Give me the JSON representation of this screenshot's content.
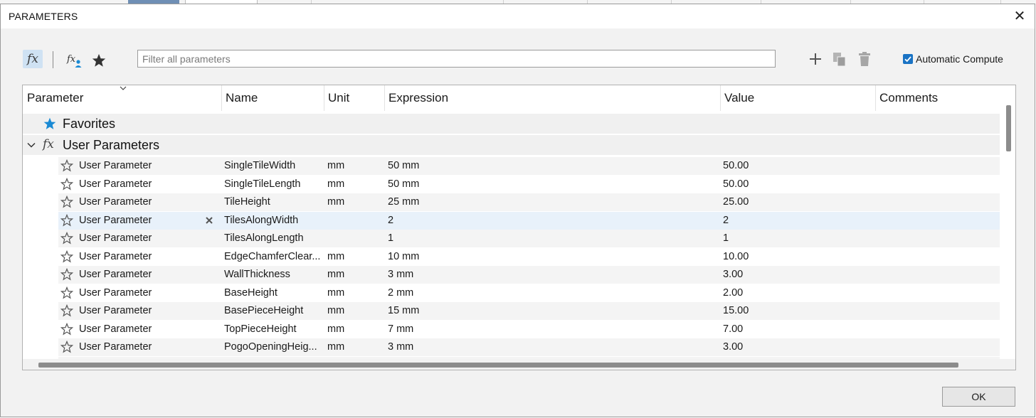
{
  "dialog": {
    "title": "PARAMETERS"
  },
  "toolbar": {
    "filter_placeholder": "Filter all parameters",
    "auto_compute_label": "Automatic Compute",
    "auto_compute_checked": true
  },
  "table": {
    "columns": [
      "Parameter",
      "Name",
      "Unit",
      "Expression",
      "Value",
      "Comments"
    ],
    "groups": {
      "favorites": "Favorites",
      "user": "User Parameters"
    },
    "rows": [
      {
        "param": "User Parameter",
        "name": "SingleTileWidth",
        "unit": "mm",
        "expr": "50 mm",
        "value": "50.00",
        "comment": ""
      },
      {
        "param": "User Parameter",
        "name": "SingleTileLength",
        "unit": "mm",
        "expr": "50 mm",
        "value": "50.00",
        "comment": ""
      },
      {
        "param": "User Parameter",
        "name": "TileHeight",
        "unit": "mm",
        "expr": "25 mm",
        "value": "25.00",
        "comment": ""
      },
      {
        "param": "User Parameter",
        "name": "TilesAlongWidth",
        "unit": "",
        "expr": "2",
        "value": "2",
        "comment": ""
      },
      {
        "param": "User Parameter",
        "name": "TilesAlongLength",
        "unit": "",
        "expr": "1",
        "value": "1",
        "comment": ""
      },
      {
        "param": "User Parameter",
        "name": "EdgeChamferClear...",
        "unit": "mm",
        "expr": "10 mm",
        "value": "10.00",
        "comment": ""
      },
      {
        "param": "User Parameter",
        "name": "WallThickness",
        "unit": "mm",
        "expr": "3 mm",
        "value": "3.00",
        "comment": ""
      },
      {
        "param": "User Parameter",
        "name": "BaseHeight",
        "unit": "mm",
        "expr": "2 mm",
        "value": "2.00",
        "comment": ""
      },
      {
        "param": "User Parameter",
        "name": "BasePieceHeight",
        "unit": "mm",
        "expr": "15 mm",
        "value": "15.00",
        "comment": ""
      },
      {
        "param": "User Parameter",
        "name": "TopPieceHeight",
        "unit": "mm",
        "expr": "7 mm",
        "value": "7.00",
        "comment": ""
      },
      {
        "param": "User Parameter",
        "name": "PogoOpeningHeig...",
        "unit": "mm",
        "expr": "3 mm",
        "value": "3.00",
        "comment": ""
      }
    ]
  },
  "buttons": {
    "ok": "OK"
  },
  "colors": {
    "accent": "#1a73c4",
    "selected_row": "#e8f1fa",
    "star_favorite": "#1a8ad4"
  },
  "icons": [
    "fx-icon",
    "fx-user-icon",
    "star-icon",
    "plus-icon",
    "copy-icon",
    "trash-icon",
    "close-icon",
    "chevron-down-icon",
    "star-outline-icon",
    "x-mark-icon"
  ]
}
